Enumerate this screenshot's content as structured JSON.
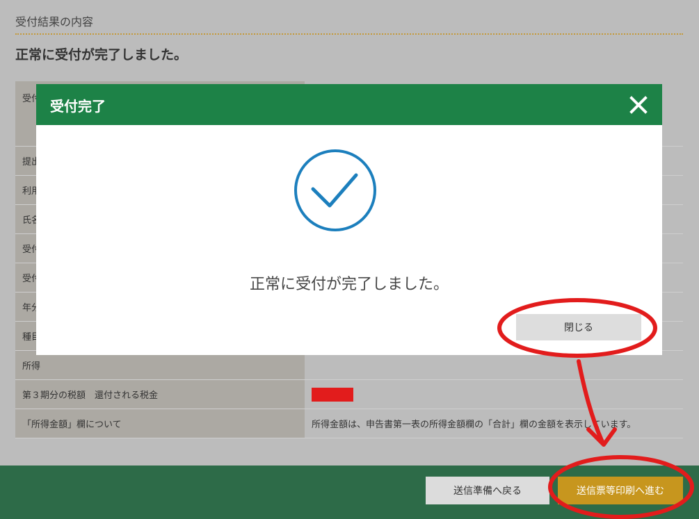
{
  "page": {
    "section_label": "受付結果の内容",
    "heading": "正常に受付が完了しました。"
  },
  "table": {
    "rows": [
      {
        "label": "受付",
        "value": ""
      },
      {
        "label": "提出",
        "value": ""
      },
      {
        "label": "利用",
        "value": ""
      },
      {
        "label": "氏名",
        "value": ""
      },
      {
        "label": "受付",
        "value": ""
      },
      {
        "label": "受付",
        "value": ""
      },
      {
        "label": "年分",
        "value": ""
      },
      {
        "label": "種目",
        "value": ""
      },
      {
        "label": "所得",
        "value": ""
      },
      {
        "label": "第３期分の税額　還付される税金",
        "value": ""
      },
      {
        "label": "「所得金額」欄について",
        "value": "所得金額は、申告書第一表の所得金額欄の「合計」欄の金額を表示しています。"
      }
    ]
  },
  "footer": {
    "back_label": "送信準備へ戻る",
    "next_label": "送信票等印刷へ進む"
  },
  "modal": {
    "title": "受付完了",
    "message": "正常に受付が完了しました。",
    "close_label": "閉じる"
  },
  "colors": {
    "header_green": "#1d8247",
    "footer_green": "#2d6b48",
    "accent_gold": "#c7961e",
    "check_blue": "#1c7fbd",
    "annotation_red": "#e21c1c"
  },
  "icons": {
    "close": "close-icon",
    "check": "check-circle-icon"
  }
}
